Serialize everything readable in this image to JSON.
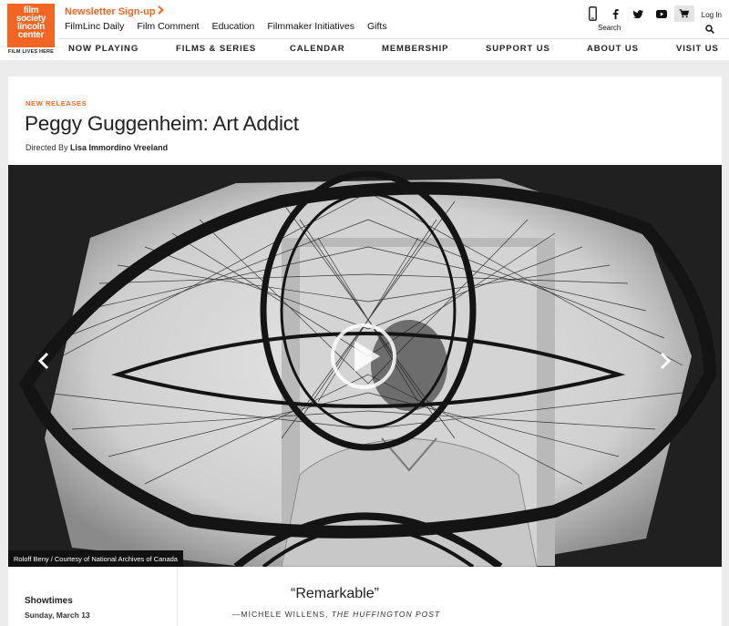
{
  "logo": {
    "line1": "film",
    "line2": "society",
    "line3": "lincoln",
    "line4": "center",
    "tagline": "FILM LIVES HERE"
  },
  "header": {
    "newsletter": "Newsletter Sign-up",
    "sublinks": [
      "FilmLinc Daily",
      "Film Comment",
      "Education",
      "Filmmaker Initiatives",
      "Gifts"
    ],
    "search_label": "Search",
    "login": "Log In",
    "icons": [
      "mobile-icon",
      "facebook-icon",
      "twitter-icon",
      "youtube-icon",
      "cart-icon",
      "search-icon"
    ]
  },
  "nav": [
    "NOW PLAYING",
    "FILMS & SERIES",
    "CALENDAR",
    "MEMBERSHIP",
    "SUPPORT US",
    "ABOUT US",
    "VISIT US"
  ],
  "film": {
    "eyebrow": "NEW RELEASES",
    "title": "Peggy Guggenheim: Art Addict",
    "directed_by_label": "Directed By",
    "director": "Lisa Immordino Vreeland",
    "photo_credit": "Roloff Beny / Courtesy of National Archives of Canada"
  },
  "showtimes": {
    "title": "Showtimes",
    "date": "Sunday, March 13"
  },
  "review": {
    "quote": "“Remarkable”",
    "author": "—MICHELE WILLENS,",
    "publication": "THE HUFFINGTON POST"
  },
  "colors": {
    "accent": "#f26522",
    "background": "#ececec"
  }
}
